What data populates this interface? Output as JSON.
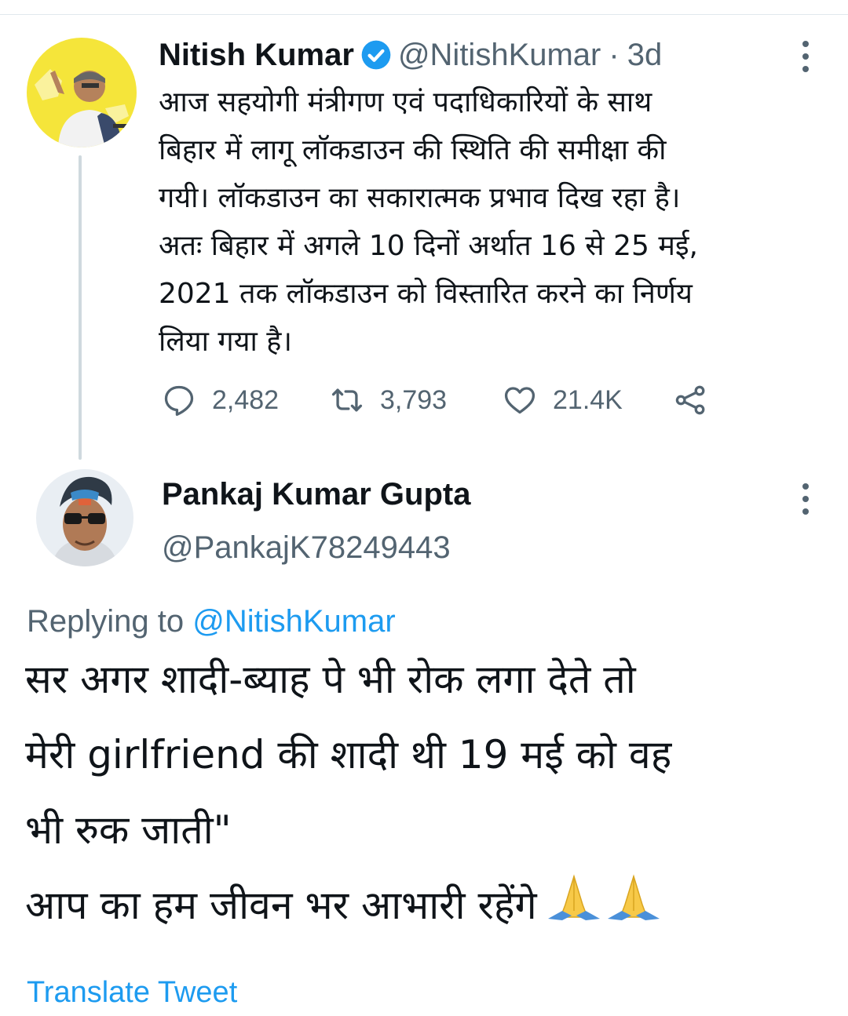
{
  "tweet": {
    "author_name": "Nitish Kumar",
    "handle": "@NitishKumar",
    "separator": "·",
    "time": "3d",
    "body_lines": [
      "आज सहयोगी मंत्रीगण एवं पदाधिकारियों के साथ",
      "बिहार में लागू लॉकडाउन की स्थिति की समीक्षा की",
      "गयी। लॉकडाउन का सकारात्मक प्रभाव दिख रहा है।",
      "अतः बिहार में अगले 10 दिनों अर्थात 16 से 25 मई,",
      "2021 तक लॉकडाउन को विस्तारित करने का निर्णय",
      "लिया गया है।"
    ],
    "replies": "2,482",
    "retweets": "3,793",
    "likes": "21.4K"
  },
  "reply": {
    "author_name": "Pankaj Kumar Gupta",
    "handle": "@PankajK78249443",
    "replying_prefix": "Replying to",
    "replying_to": "@NitishKumar",
    "body_lines": [
      "सर अगर शादी-ब्याह पे भी रोक लगा देते तो",
      "मेरी girlfriend की शादी थी 19 मई को वह",
      "भी रुक जाती\"",
      "आप का हम जीवन भर आभारी रहेंगे"
    ],
    "translate_label": "Translate Tweet"
  },
  "icons": {
    "verified": "verified-badge-icon",
    "reply": "reply-icon",
    "retweet": "retweet-icon",
    "like": "heart-icon",
    "share": "share-icon",
    "more": "more-vertical-icon",
    "emoji": "folded-hands-emoji"
  },
  "colors": {
    "link": "#1d9bf0",
    "secondary_text": "#536471",
    "primary_text": "#0f1419",
    "avatar_bg_yellow": "#f5e53a"
  }
}
